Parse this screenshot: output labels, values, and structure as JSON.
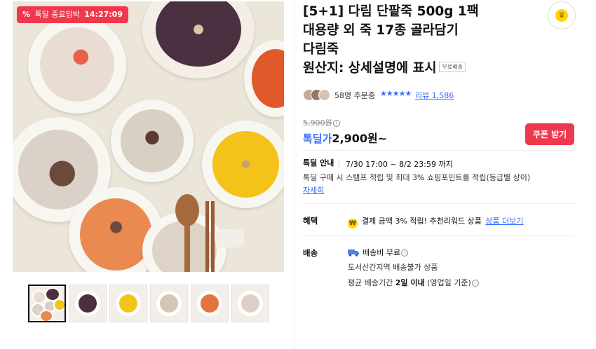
{
  "gallery": {
    "deal_badge": {
      "icon": "percent-icon",
      "label": "톡딜 종료임박",
      "timer": "14:27:09"
    },
    "thumbnail_count": 6,
    "active_thumbnail": 1
  },
  "product": {
    "title_lines": [
      "[5+1] 다림 단팥죽 500g 1팩",
      "대용량 외 죽 17종 골라담기",
      "다림죽",
      "원산지: 상세설명에 표시"
    ],
    "free_shipping_tag": "무료배송",
    "order_count": "58명 주문중",
    "rating_stars": 4.5,
    "review_link": "리뷰 1,586",
    "original_price": "5,900원",
    "price_label": "톡딜가",
    "price": "2,900원~",
    "coupon_button": "쿠폰 받기"
  },
  "deal": {
    "label": "톡딜 안내",
    "period": "7/30 17:00 ~ 8/2 23:59 까지",
    "description": "톡딜 구매 시 스탬프 적립 및 최대 3% 쇼핑포인트를 적립(등급별 상이)",
    "more_link": "자세히"
  },
  "benefit": {
    "label": "혜택",
    "icon": "won-coin-icon",
    "text": "결제 금액 3% 적립! 추천리워드 상품",
    "link": "상품 더보기"
  },
  "shipping": {
    "label": "배송",
    "icon": "truck-icon",
    "fee": "배송비 무료",
    "restriction": "도서산간지역 배송불가 상품",
    "avg_prefix": "평균 배송기간",
    "avg_value": "2일 이내",
    "avg_suffix": "(영업일 기준)"
  },
  "colors": {
    "accent_red": "#f0384d",
    "link_blue": "#346aff",
    "coin_yellow": "#ffd400"
  }
}
